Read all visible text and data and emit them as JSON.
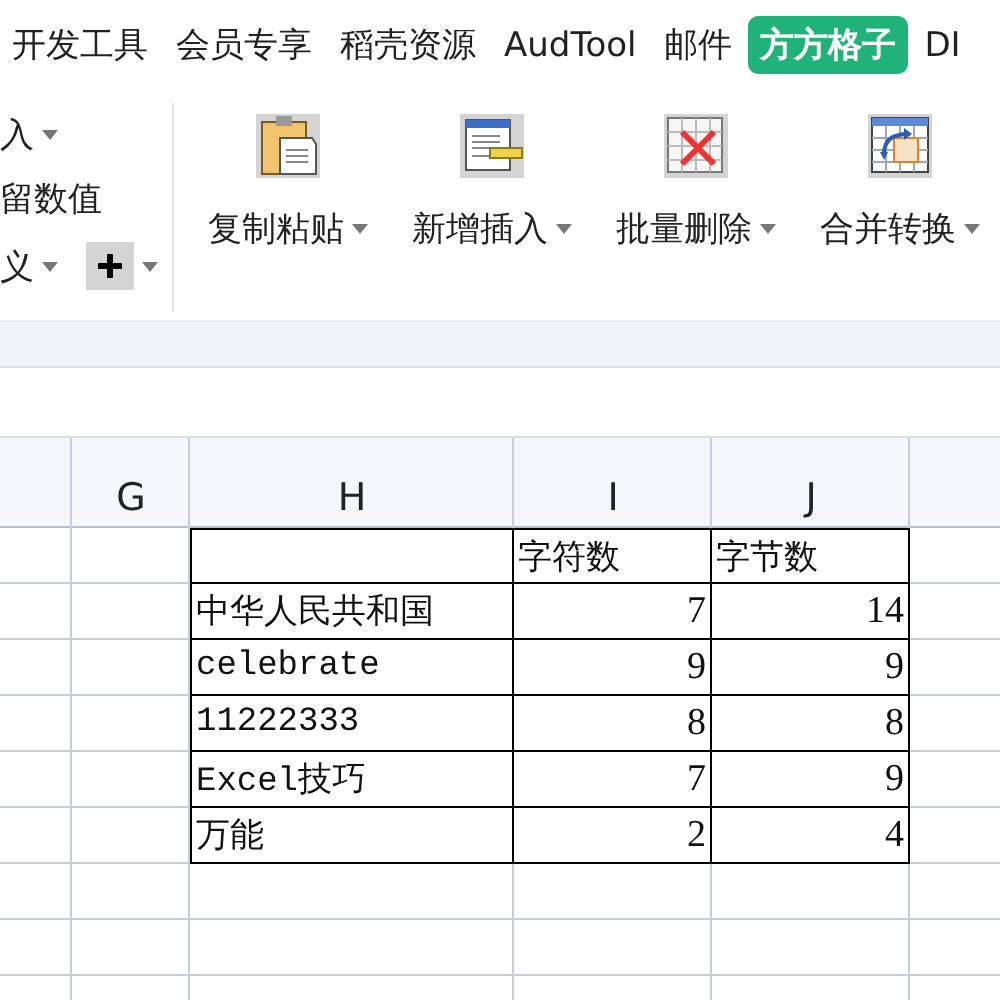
{
  "menu_tabs": [
    {
      "label": "开发工具",
      "selected": false
    },
    {
      "label": "会员专享",
      "selected": false
    },
    {
      "label": "稻壳资源",
      "selected": false
    },
    {
      "label": "AudTool",
      "selected": false
    },
    {
      "label": "邮件",
      "selected": false
    },
    {
      "label": "方方格子",
      "selected": true
    },
    {
      "label": "DI",
      "selected": false
    }
  ],
  "ribbon": {
    "left_items": [
      {
        "label": "入",
        "kind": "dropdown"
      },
      {
        "label": "留数值",
        "kind": "plain"
      },
      {
        "label": "义",
        "kind": "dropdown_plus"
      }
    ],
    "big_buttons": [
      {
        "label": "复制粘贴",
        "kind": "clipboard"
      },
      {
        "label": "新增插入",
        "kind": "insert"
      },
      {
        "label": "批量删除",
        "kind": "delete"
      },
      {
        "label": "合并转换",
        "kind": "merge"
      }
    ]
  },
  "sheet": {
    "columns": [
      "G",
      "H",
      "I",
      "J"
    ],
    "rows": [
      {
        "kind": "header",
        "i": "字符数",
        "j": "字节数"
      },
      {
        "kind": "data",
        "h": "中华人民共和国",
        "i": "7",
        "j": "14"
      },
      {
        "kind": "data",
        "h": "celebrate",
        "i": "9",
        "j": "9"
      },
      {
        "kind": "data",
        "h": "11222333",
        "i": "8",
        "j": "8"
      },
      {
        "kind": "data",
        "h": "Excel技巧",
        "i": "7",
        "j": "9"
      },
      {
        "kind": "data",
        "h": "万能",
        "i": "2",
        "j": "4"
      }
    ]
  }
}
